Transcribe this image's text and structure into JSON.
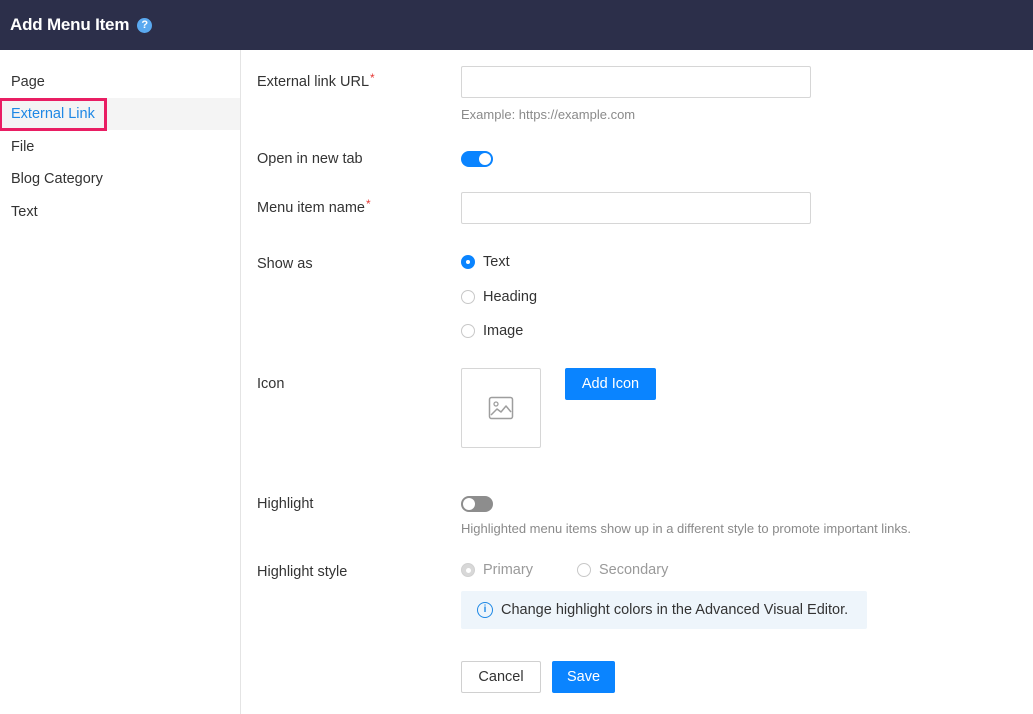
{
  "header": {
    "title": "Add Menu Item",
    "help_icon": "?"
  },
  "sidebar": {
    "items": [
      {
        "label": "Page"
      },
      {
        "label": "External Link",
        "active": true
      },
      {
        "label": "File"
      },
      {
        "label": "Blog Category"
      },
      {
        "label": "Text"
      }
    ]
  },
  "form": {
    "url": {
      "label": "External link URL",
      "required_mark": "*",
      "value": "",
      "hint": "Example: https://example.com"
    },
    "new_tab": {
      "label": "Open in new tab",
      "enabled": true
    },
    "name": {
      "label": "Menu item name",
      "required_mark": "*",
      "value": ""
    },
    "show_as": {
      "label": "Show as",
      "options": [
        {
          "label": "Text",
          "selected": true
        },
        {
          "label": "Heading",
          "selected": false
        },
        {
          "label": "Image",
          "selected": false
        }
      ]
    },
    "icon": {
      "label": "Icon",
      "placeholder_icon": "image-placeholder-icon",
      "add_button": "Add Icon"
    },
    "highlight": {
      "label": "Highlight",
      "enabled": false,
      "hint": "Highlighted menu items show up in a different style to promote important links."
    },
    "highlight_style": {
      "label": "Highlight style",
      "options": [
        {
          "label": "Primary",
          "selected": true
        },
        {
          "label": "Secondary",
          "selected": false
        }
      ],
      "info_icon": "i",
      "info": "Change highlight colors in the Advanced Visual Editor."
    }
  },
  "actions": {
    "cancel": "Cancel",
    "save": "Save"
  },
  "colors": {
    "header_bg": "#2c2f4a",
    "accent": "#0a84ff",
    "active_outline": "#e91e63",
    "required": "#e53935"
  }
}
